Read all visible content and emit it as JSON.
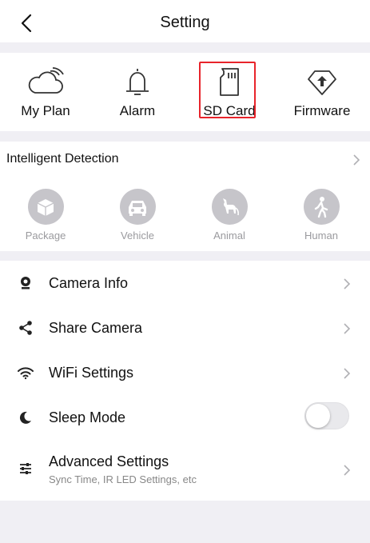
{
  "header": {
    "title": "Setting"
  },
  "quick_actions": [
    {
      "label": "My Plan",
      "icon": "cloud-icon"
    },
    {
      "label": "Alarm",
      "icon": "bell-icon"
    },
    {
      "label": "SD Card",
      "icon": "sd-card-icon",
      "highlighted": true
    },
    {
      "label": "Firmware",
      "icon": "firmware-icon"
    }
  ],
  "detection": {
    "title": "Intelligent Detection",
    "items": [
      {
        "label": "Package",
        "icon": "package-icon"
      },
      {
        "label": "Vehicle",
        "icon": "vehicle-icon"
      },
      {
        "label": "Animal",
        "icon": "animal-icon"
      },
      {
        "label": "Human",
        "icon": "human-icon"
      }
    ]
  },
  "settings": [
    {
      "label": "Camera Info",
      "icon": "camera-icon"
    },
    {
      "label": "Share Camera",
      "icon": "share-icon"
    },
    {
      "label": "WiFi Settings",
      "icon": "wifi-icon"
    },
    {
      "label": "Sleep Mode",
      "icon": "moon-icon",
      "toggle": false
    },
    {
      "label": "Advanced  Settings",
      "sub": "Sync Time, IR LED Settings, etc",
      "icon": "sliders-icon"
    }
  ],
  "colors": {
    "highlight": "#e8242b",
    "detection_icon_bg": "#c6c5ca"
  }
}
